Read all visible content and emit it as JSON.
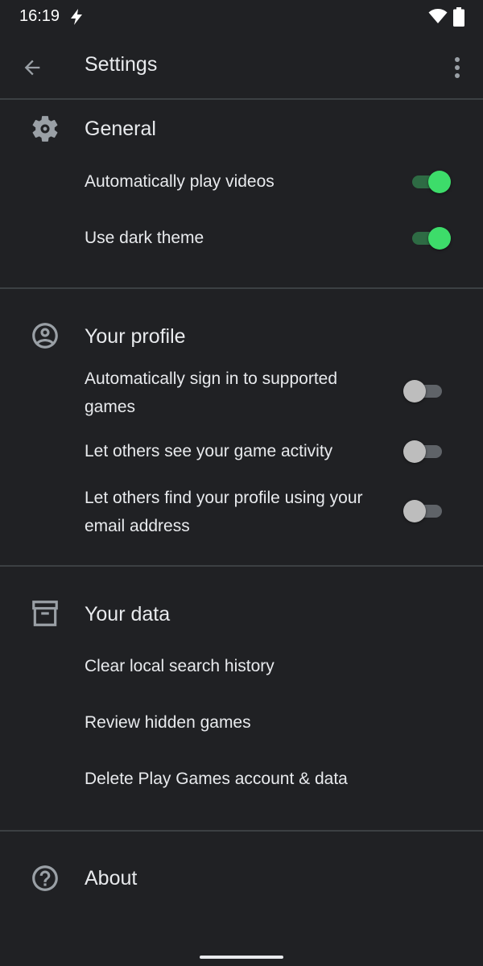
{
  "status_bar": {
    "time": "16:19"
  },
  "app_bar": {
    "title": "Settings"
  },
  "sections": {
    "general": {
      "title": "General",
      "icon": "gear-icon",
      "items": [
        {
          "label": "Automatically play videos",
          "toggle": true
        },
        {
          "label": "Use dark theme",
          "toggle": true
        }
      ]
    },
    "profile": {
      "title": "Your profile",
      "icon": "account-circle-icon",
      "items": [
        {
          "label": "Automatically sign in to supported games",
          "toggle": false
        },
        {
          "label": "Let others see your game activity",
          "toggle": false
        },
        {
          "label": "Let others find your profile using your email address",
          "toggle": false
        }
      ]
    },
    "data": {
      "title": "Your data",
      "icon": "archive-icon",
      "items": [
        {
          "label": "Clear local search history"
        },
        {
          "label": "Review hidden games"
        },
        {
          "label": "Delete Play Games account & data"
        }
      ]
    },
    "about": {
      "title": "About",
      "icon": "help-circle-icon"
    }
  },
  "colors": {
    "background": "#202124",
    "divider": "#3c4043",
    "toggle_on_thumb": "#3ddc6a",
    "toggle_on_track": "#2e6b44",
    "toggle_off_thumb": "#bdbdbd",
    "toggle_off_track": "#5f6368"
  }
}
